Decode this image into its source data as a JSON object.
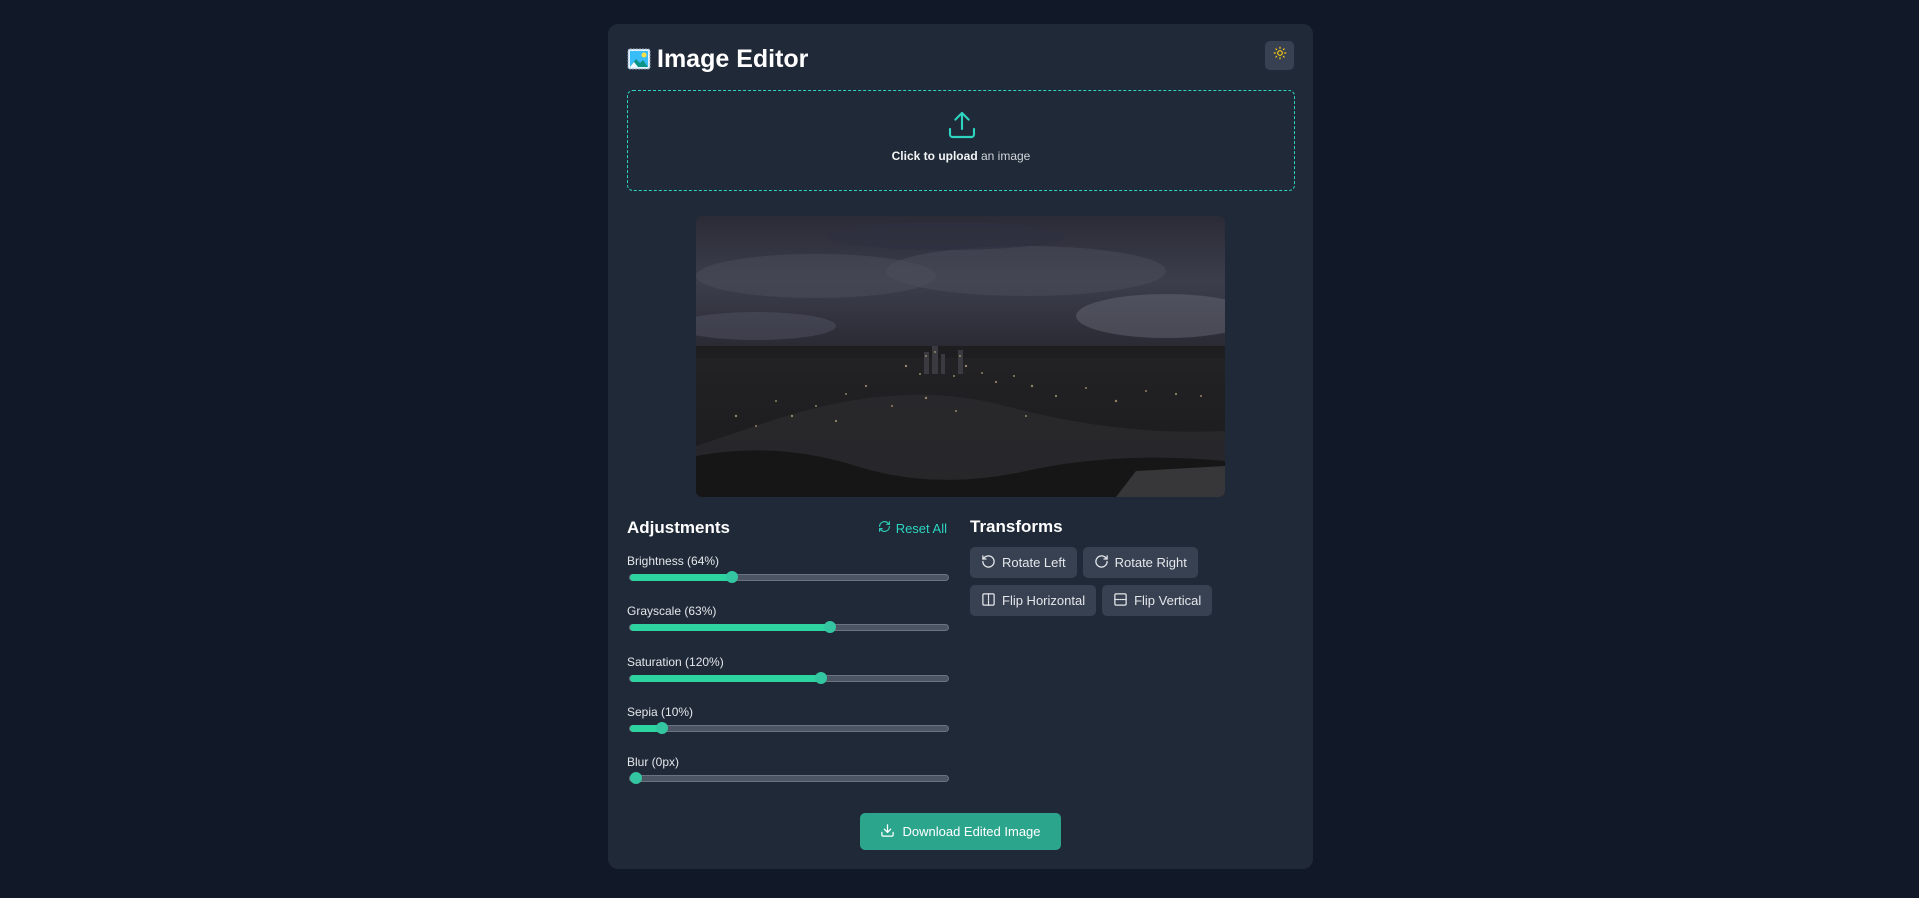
{
  "app": {
    "title": "Image Editor",
    "app_icon": "picture-icon",
    "theme_toggle_icon": "sun-icon"
  },
  "upload": {
    "icon": "upload-icon",
    "strong_text": "Click to upload",
    "rest_text": " an image"
  },
  "preview": {
    "description_icon": "image-preview"
  },
  "adjustments": {
    "title": "Adjustments",
    "reset_label": "Reset All",
    "sliders": [
      {
        "label": "Brightness (64%)",
        "fraction": 0.32
      },
      {
        "label": "Grayscale (63%)",
        "fraction": 0.63
      },
      {
        "label": "Saturation (120%)",
        "fraction": 0.6
      },
      {
        "label": "Sepia (10%)",
        "fraction": 0.1
      },
      {
        "label": "Blur (0px)",
        "fraction": 0.0
      }
    ]
  },
  "transforms": {
    "title": "Transforms",
    "rotate_left": "Rotate Left",
    "rotate_right": "Rotate Right",
    "flip_horizontal": "Flip Horizontal",
    "flip_vertical": "Flip Vertical"
  },
  "download": {
    "label": "Download Edited Image"
  },
  "colors": {
    "accent": "#2dd4bf",
    "button_primary": "#2ca58d",
    "background": "#111827",
    "card": "#1f2937"
  }
}
